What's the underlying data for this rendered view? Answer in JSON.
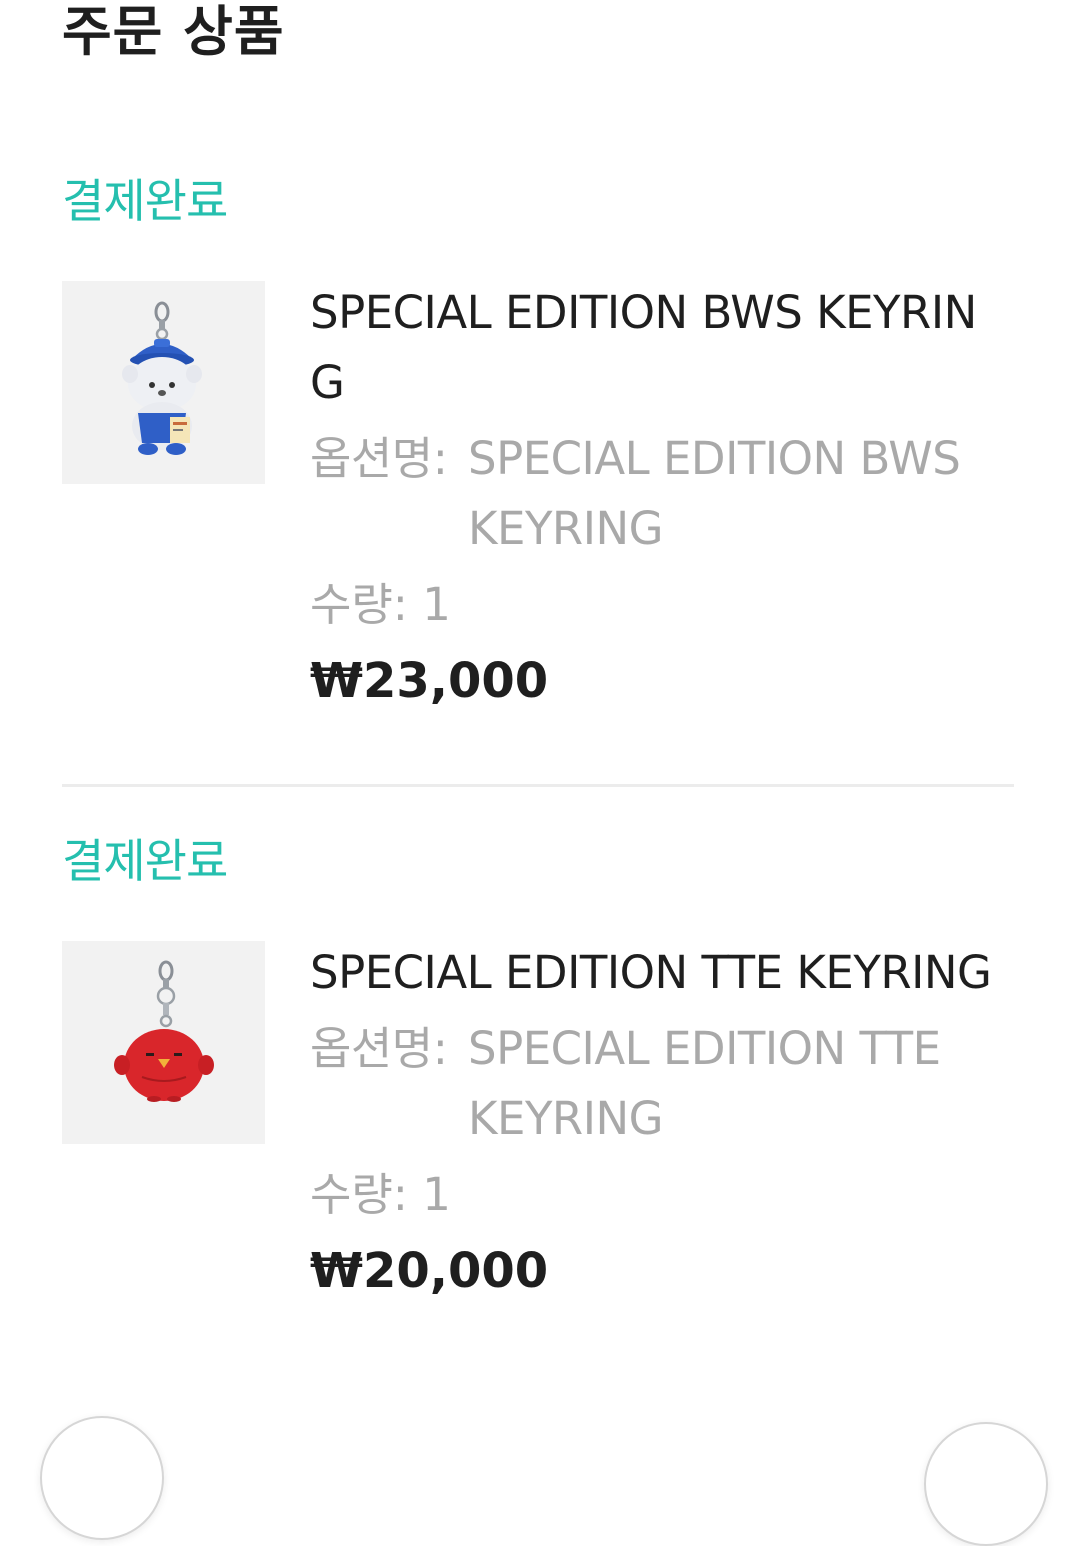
{
  "page": {
    "title": "주문 상품"
  },
  "orders": [
    {
      "status": "결제완료",
      "thumbnail_icon": "bear-keyring-image",
      "name": "SPECIAL EDITION BWS KEYRING",
      "option_label": "옵션명:",
      "option_value": "SPECIAL EDITION BWS KEYRING",
      "qty_label": "수량: 1",
      "price": "₩23,000"
    },
    {
      "status": "결제완료",
      "thumbnail_icon": "red-bird-keyring-image",
      "name": "SPECIAL EDITION TTE KEYRING",
      "option_label": "옵션명:",
      "option_value": "SPECIAL EDITION TTE KEYRING",
      "qty_label": "수량: 1",
      "price": "₩20,000"
    }
  ],
  "colors": {
    "status": "#25bfae",
    "primary_text": "#1f1f1f",
    "secondary_text": "#a9a9a9",
    "thumbnail_bg": "#f2f2f2"
  }
}
